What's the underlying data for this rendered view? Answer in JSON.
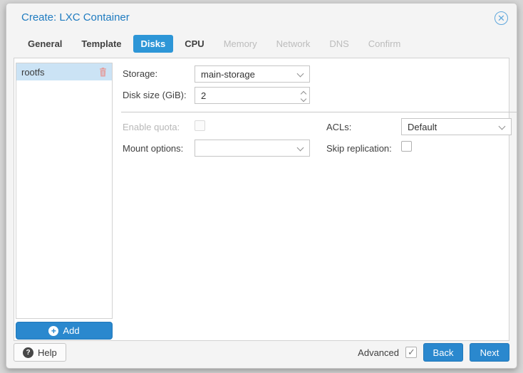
{
  "window": {
    "title": "Create: LXC Container",
    "close_icon": "circle-x"
  },
  "tabs": [
    {
      "label": "General",
      "state": "enabled"
    },
    {
      "label": "Template",
      "state": "enabled"
    },
    {
      "label": "Disks",
      "state": "active"
    },
    {
      "label": "CPU",
      "state": "enabled"
    },
    {
      "label": "Memory",
      "state": "disabled"
    },
    {
      "label": "Network",
      "state": "disabled"
    },
    {
      "label": "DNS",
      "state": "disabled"
    },
    {
      "label": "Confirm",
      "state": "disabled"
    }
  ],
  "disk_panel": {
    "items": [
      {
        "name": "rootfs",
        "selected": true
      }
    ],
    "add_button": "Add"
  },
  "form": {
    "storage": {
      "label": "Storage:",
      "value": "main-storage"
    },
    "disk_size": {
      "label": "Disk size (GiB):",
      "value": "2"
    },
    "enable_quota": {
      "label": "Enable quota:",
      "checked": false,
      "disabled": true
    },
    "mount_options": {
      "label": "Mount options:",
      "value": ""
    },
    "acls": {
      "label": "ACLs:",
      "value": "Default"
    },
    "skip_replication": {
      "label": "Skip replication:",
      "checked": false
    }
  },
  "footer": {
    "help": "Help",
    "advanced_label": "Advanced",
    "advanced_checked": true,
    "back": "Back",
    "next": "Next"
  },
  "colors": {
    "title_blue": "#1e7bc0",
    "tab_active_bg": "#2d96d7",
    "button_blue": "#2a88ce",
    "selected_row_bg": "#cbe3f5",
    "trash_icon": "#e39f9f",
    "page_background": "#d6d6d6"
  }
}
